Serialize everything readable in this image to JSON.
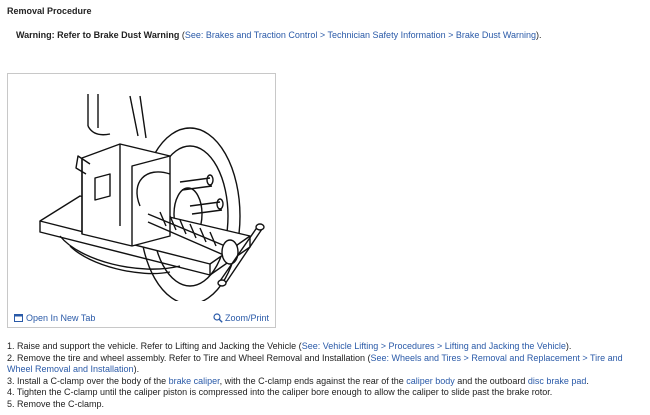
{
  "heading": "Removal Procedure",
  "warning": {
    "label": "Warning: Refer to Brake Dust Warning",
    "open_paren": " (",
    "see": "See: Brakes and Traction Control > Technician Safety Information > Brake Dust Warning",
    "close_paren": ")."
  },
  "figure": {
    "open_tab": "Open In New Tab",
    "zoom": "Zoom/Print"
  },
  "steps": [
    {
      "text1": "1. Raise and support the vehicle. Refer to Lifting and Jacking the Vehicle (",
      "link1": "See: Vehicle Lifting > Procedures > Lifting and Jacking the Vehicle",
      "text2": ")."
    },
    {
      "text1": "2. Remove the tire and wheel assembly. Refer to Tire and Wheel Removal and Installation (",
      "link1": "See: Wheels and Tires > Removal and Replacement > Tire and Wheel Removal and Installation",
      "text2": ")."
    },
    {
      "text1": "3. Install a C-clamp over the body of the ",
      "link1": "brake caliper",
      "text2": ", with the C-clamp ends against the rear of the ",
      "link2": "caliper body",
      "text3": " and the outboard ",
      "link3": "disc brake pad",
      "text4": "."
    },
    {
      "text1": "4. Tighten the C-clamp until the caliper piston is compressed into the caliper bore enough to allow the caliper to slide past the brake rotor."
    },
    {
      "text1": "5. Remove the C-clamp."
    }
  ]
}
